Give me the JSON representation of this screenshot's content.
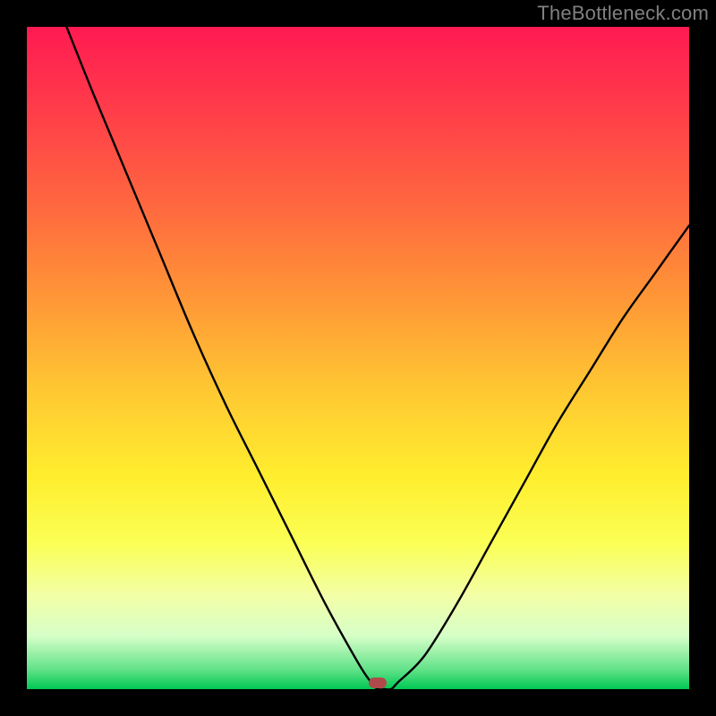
{
  "watermark": "TheBottleneck.com",
  "chart_data": {
    "type": "line",
    "title": "",
    "xlabel": "",
    "ylabel": "",
    "xlim": [
      0,
      100
    ],
    "ylim": [
      0,
      100
    ],
    "background_gradient": {
      "direction": "top-to-bottom",
      "stops": [
        {
          "pos": 0,
          "color": "#ff1a52"
        },
        {
          "pos": 12,
          "color": "#ff3b4a"
        },
        {
          "pos": 28,
          "color": "#ff6b3e"
        },
        {
          "pos": 42,
          "color": "#ff9a36"
        },
        {
          "pos": 55,
          "color": "#ffc832"
        },
        {
          "pos": 68,
          "color": "#ffee2e"
        },
        {
          "pos": 78,
          "color": "#fbff55"
        },
        {
          "pos": 86,
          "color": "#f2ffa8"
        },
        {
          "pos": 92,
          "color": "#d6ffc8"
        },
        {
          "pos": 97,
          "color": "#63e28a"
        },
        {
          "pos": 100,
          "color": "#00c853"
        }
      ]
    },
    "series": [
      {
        "name": "bottleneck-curve",
        "x": [
          6,
          10,
          15,
          20,
          25,
          30,
          35,
          40,
          45,
          50,
          52,
          53,
          54,
          55,
          56,
          60,
          65,
          70,
          75,
          80,
          85,
          90,
          95,
          100
        ],
        "y": [
          100,
          90,
          78,
          66,
          54,
          43,
          33,
          23,
          13,
          4,
          1,
          0,
          0,
          0,
          1,
          5,
          13,
          22,
          31,
          40,
          48,
          56,
          63,
          70
        ]
      }
    ],
    "marker": {
      "name": "optimum-marker",
      "x": 53,
      "y": 1,
      "color": "#b04a4a",
      "shape": "rounded-rect"
    }
  }
}
